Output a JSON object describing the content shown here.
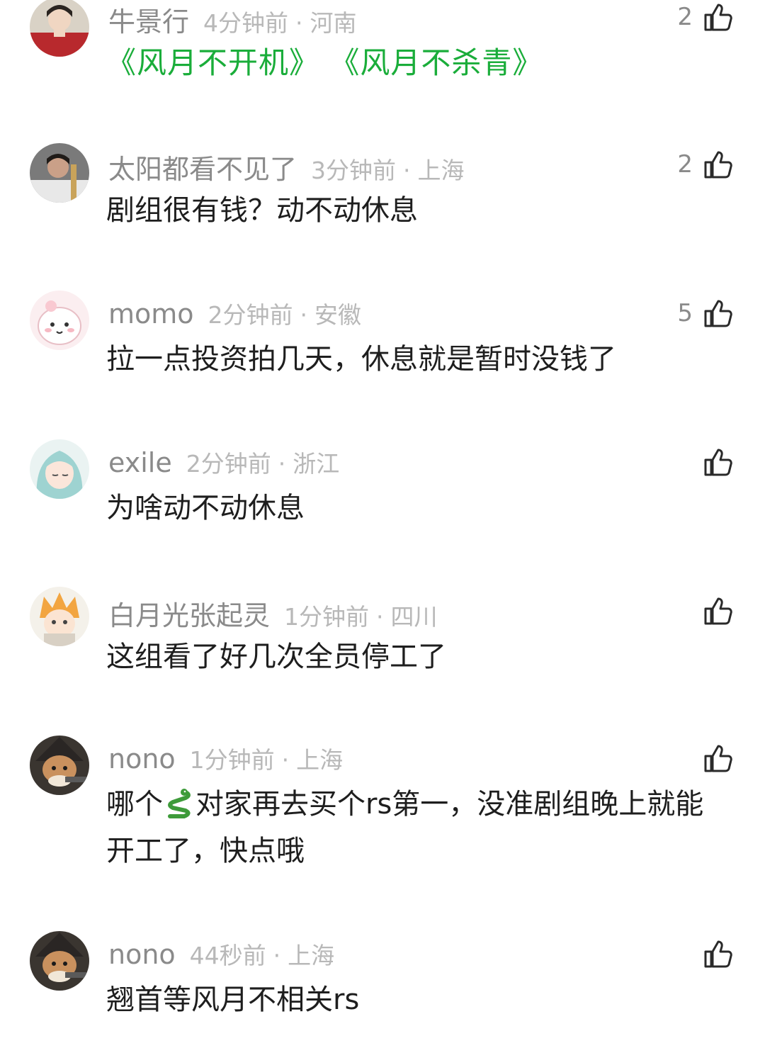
{
  "comments": [
    {
      "user": "牛景行",
      "time": "4分钟前",
      "location": "河南",
      "likes": "2",
      "content": "《风月不开机》 《风月不杀青》",
      "content_color": "#1aad3a"
    },
    {
      "user": "太阳都看不见了",
      "time": "3分钟前",
      "location": "上海",
      "likes": "2",
      "content": "剧组很有钱？动不动休息"
    },
    {
      "user": "momo",
      "time": "2分钟前",
      "location": "安徽",
      "likes": "5",
      "content": "拉一点投资拍几天，休息就是暂时没钱了"
    },
    {
      "user": "exile",
      "time": "2分钟前",
      "location": "浙江",
      "likes": "",
      "content": "为啥动不动休息"
    },
    {
      "user": "白月光张起灵",
      "time": "1分钟前",
      "location": "四川",
      "likes": "",
      "content": "这组看了好几次全员停工了"
    },
    {
      "user": "nono",
      "time": "1分钟前",
      "location": "上海",
      "likes": "",
      "content_before_emoji": "哪个",
      "emoji": "snake-emoji",
      "content_after_emoji": "对家再去买个rs第一，没准剧组晚上就能开工了，快点哦"
    },
    {
      "user": "nono",
      "time": "44秒前",
      "location": "上海",
      "likes": "",
      "content": "翘首等风月不相关rs"
    }
  ],
  "separator": "·",
  "icons": {
    "like": "thumbs-up-icon",
    "avatar": "avatar"
  },
  "colors": {
    "username": "#8a8a8a",
    "meta": "#b8b8b8",
    "content": "#1e1e1e",
    "highlight": "#1aad3a"
  }
}
